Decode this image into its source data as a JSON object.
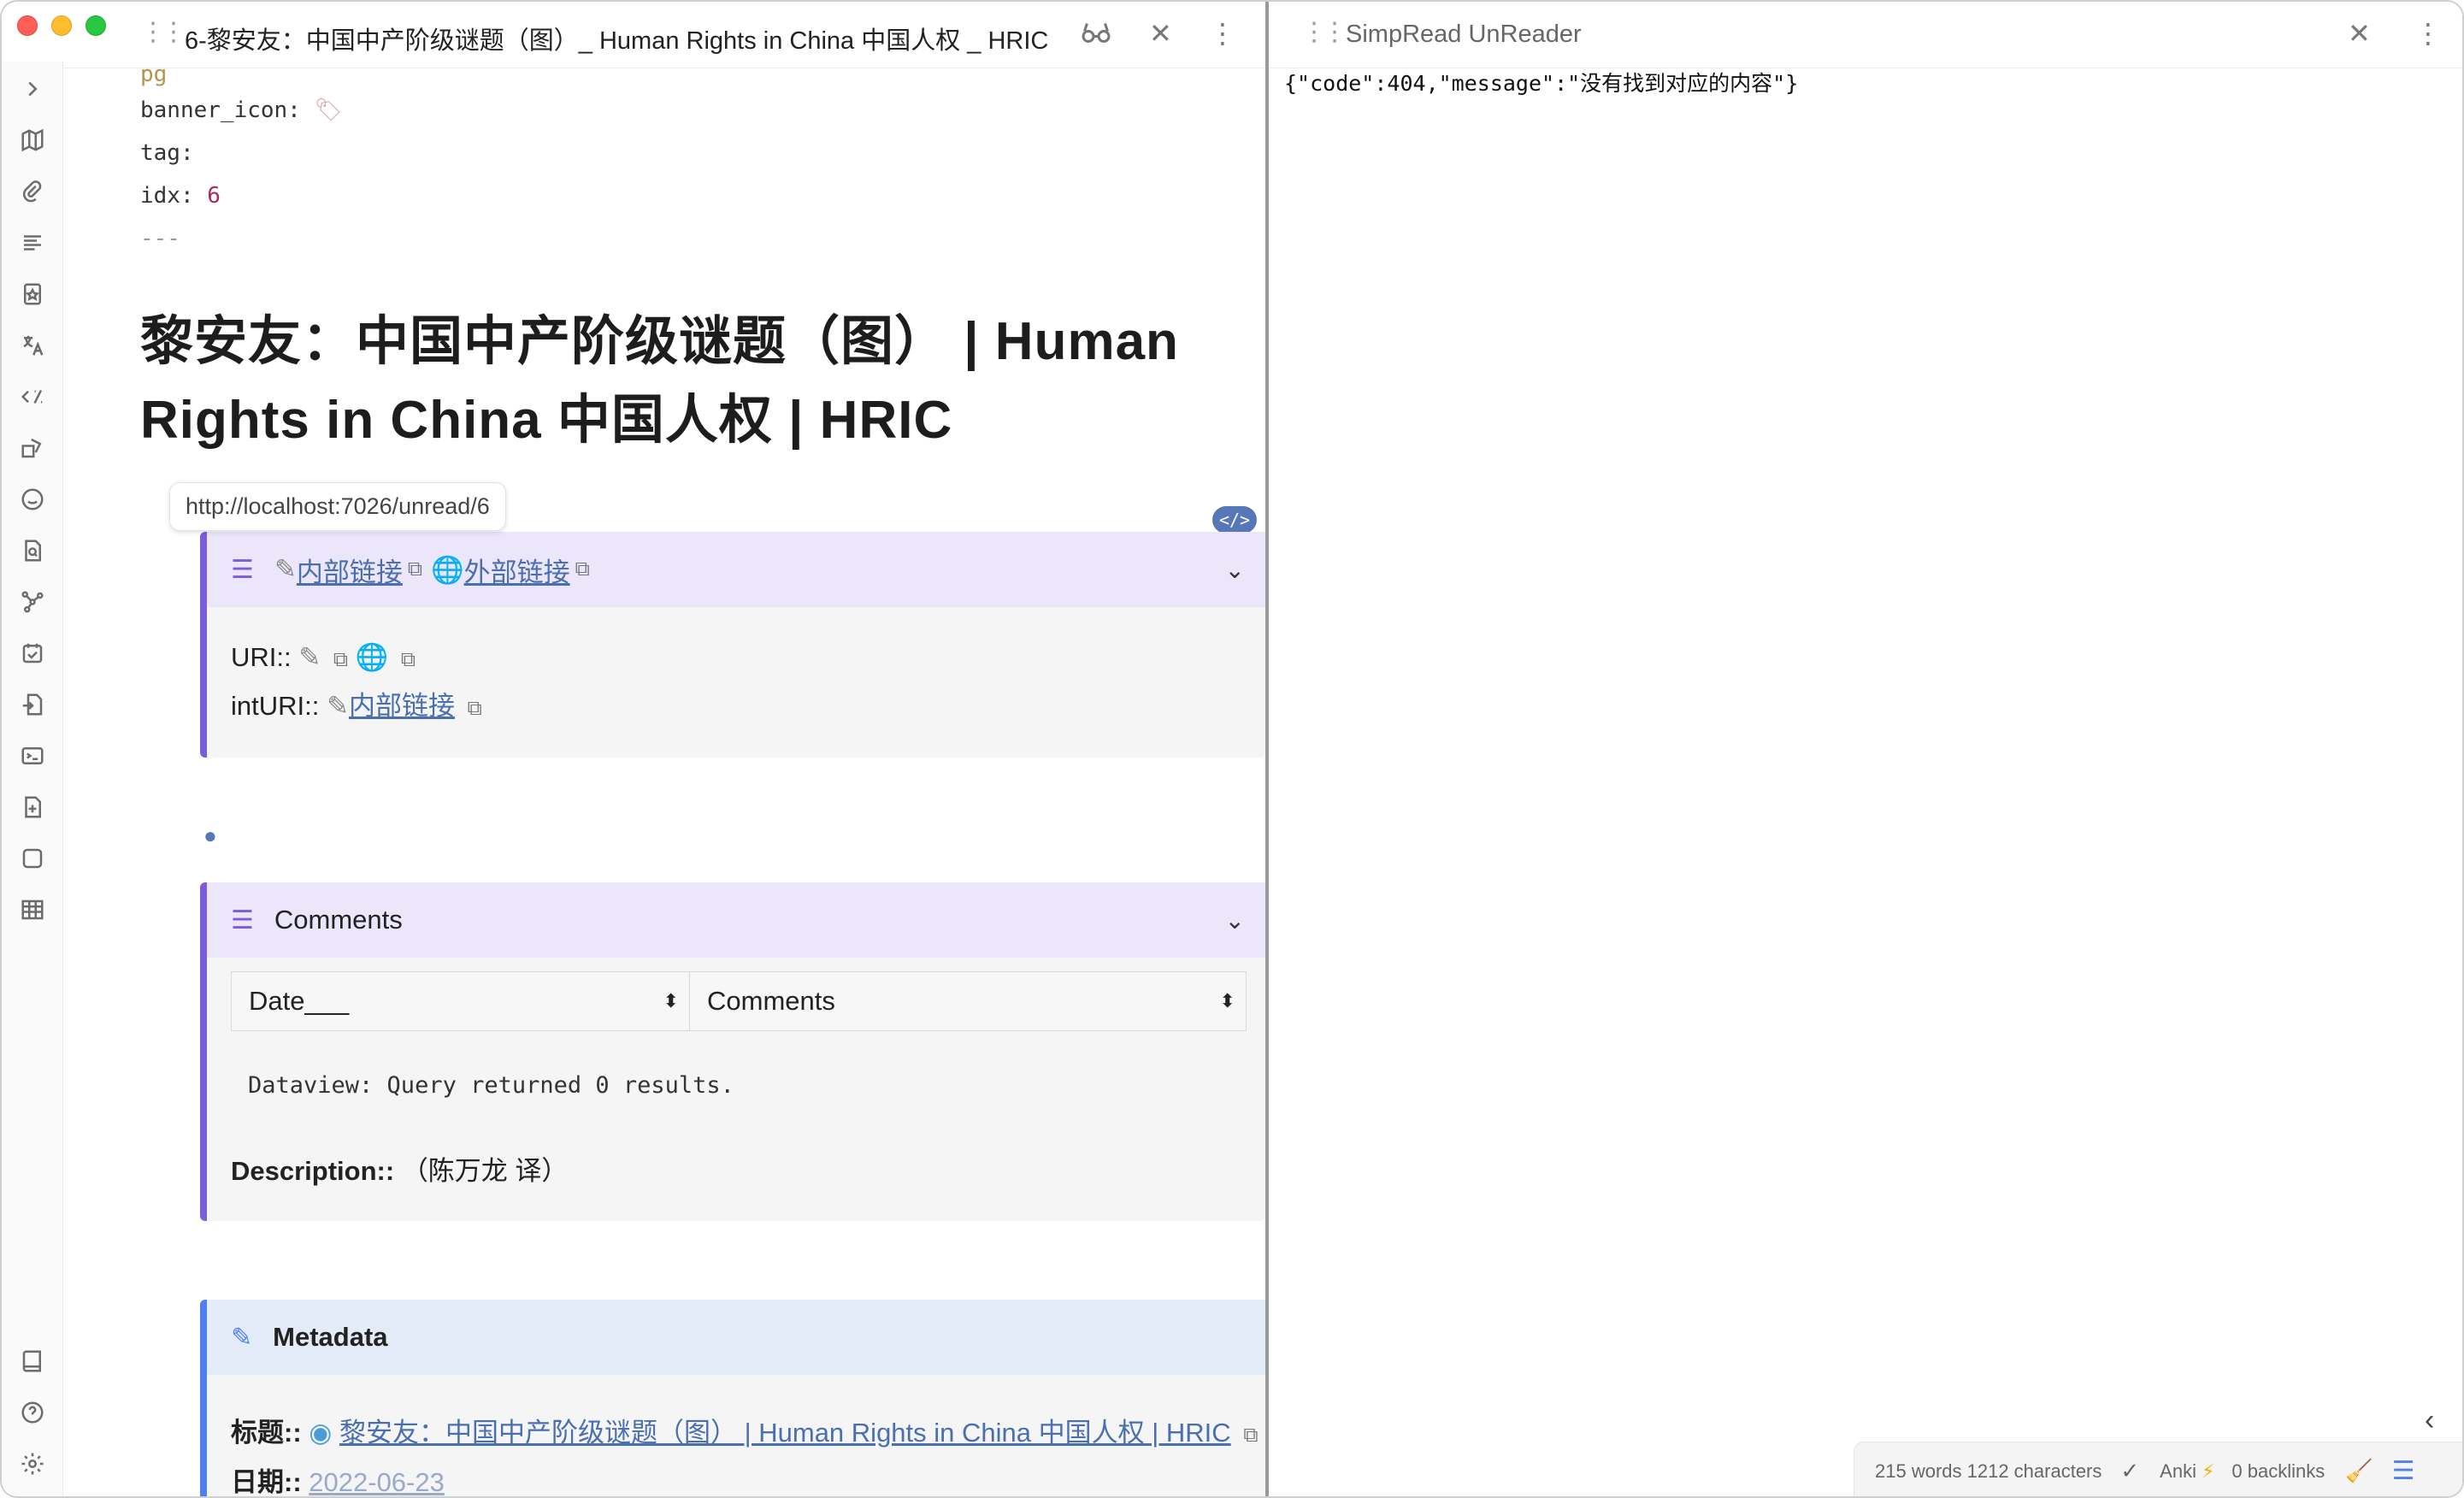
{
  "left_tab": {
    "title": "6-黎安友：中国中产阶级谜题（图）_ Human Rights in China 中国人权 _ HRIC"
  },
  "frontmatter": {
    "pg_fragment": "pg",
    "banner_icon_key": "banner_icon:",
    "tag_key": "tag:",
    "idx_key": "idx:",
    "idx_value": "6",
    "separator": "---"
  },
  "heading": "黎安友：中国中产阶级谜题（图） | Human Rights in China 中国人权 | HRIC",
  "tooltip": "http://localhost:7026/unread/6",
  "code_pill": "</>",
  "links_callout": {
    "internal_link": "内部链接",
    "external_link": "外部链接",
    "uri_label": "URI::",
    "int_uri_label": "intURI::",
    "int_uri_link": "内部链接"
  },
  "comments_callout": {
    "title": "Comments",
    "columns": [
      "Date___",
      "Comments"
    ],
    "dataview_message": "Dataview: Query returned 0 results.",
    "description_label": "Description::",
    "description_value": "（陈万龙 译）"
  },
  "metadata_callout": {
    "title": "Metadata",
    "title_label": "标题::",
    "title_link": "黎安友：中国中产阶级谜题（图） | Human Rights in China 中国人权 | HRIC",
    "date_label": "日期::",
    "date_value": "2022-06-23"
  },
  "right_tab": {
    "title": "SimpRead UnReader",
    "content": "{\"code\":404,\"message\":\"没有找到对应的内容\"}"
  },
  "status_bar": {
    "word_count": "215 words 1212 characters",
    "anki": "Anki",
    "backlinks": "0 backlinks"
  },
  "colors": {
    "accent_purple": "#7c5cdb",
    "accent_blue": "#4f7ff0",
    "link": "#4a6fb1"
  }
}
